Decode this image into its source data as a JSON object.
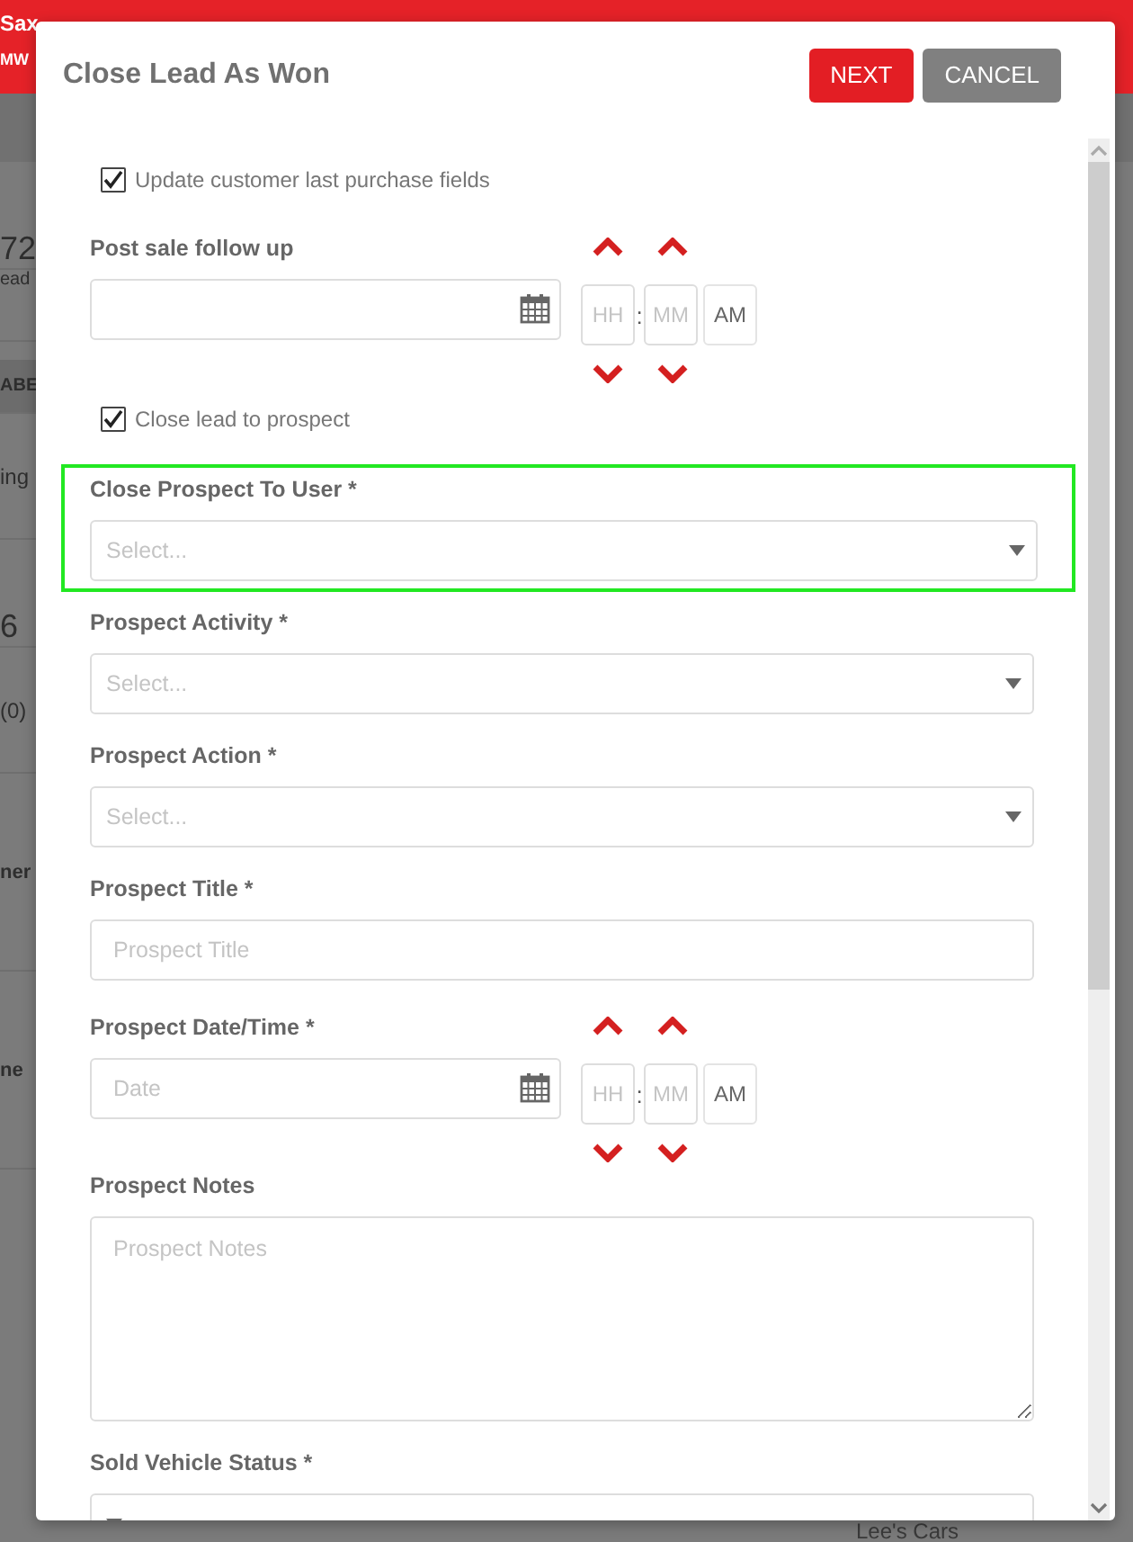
{
  "background": {
    "header_texts": [
      "Sax",
      "MW"
    ],
    "side_texts": [
      {
        "text": "72",
        "kind": "big"
      },
      {
        "text": "ead",
        "kind": "small"
      },
      {
        "text": "ABE",
        "kind": "band"
      },
      {
        "text": "ing",
        "kind": "plain"
      },
      {
        "text": "6",
        "kind": "big"
      },
      {
        "text": "(0)",
        "kind": "plain"
      },
      {
        "text": "ner",
        "kind": "bold"
      },
      {
        "text": "ne",
        "kind": "bold"
      }
    ],
    "corner_text": "Lee's Cars"
  },
  "dialog": {
    "title": "Close Lead As Won",
    "buttons": [
      {
        "label": "NEXT",
        "kind": "primary"
      },
      {
        "label": "CANCEL",
        "kind": "secondary"
      }
    ],
    "fields": [
      {
        "kind": "checkbox",
        "label": "Update customer last purchase fields",
        "checked": true
      },
      {
        "kind": "datetime",
        "label": "Post sale follow up",
        "hour_placeholder": "HH",
        "time_separator": ":",
        "minute_placeholder": "MM",
        "period": "AM"
      },
      {
        "kind": "checkbox",
        "label": "Close lead to prospect",
        "checked": true
      },
      {
        "kind": "select",
        "label": "Close Prospect To User *",
        "placeholder": "Select...",
        "highlighted": true
      },
      {
        "kind": "select",
        "label": "Prospect Activity *",
        "placeholder": "Select...",
        "highlighted": false
      },
      {
        "kind": "select",
        "label": "Prospect Action *",
        "placeholder": "Select...",
        "highlighted": false
      },
      {
        "kind": "text",
        "label": "Prospect Title *",
        "placeholder": "Prospect Title"
      },
      {
        "kind": "datetime",
        "label": "Prospect Date/Time *",
        "placeholder": "Date",
        "hour_placeholder": "HH",
        "time_separator": ":",
        "minute_placeholder": "MM",
        "period": "AM"
      },
      {
        "kind": "textarea",
        "label": "Prospect Notes",
        "placeholder": "Prospect Notes"
      },
      {
        "kind": "select",
        "label": "Sold Vehicle Status *",
        "highlighted": false
      }
    ]
  }
}
